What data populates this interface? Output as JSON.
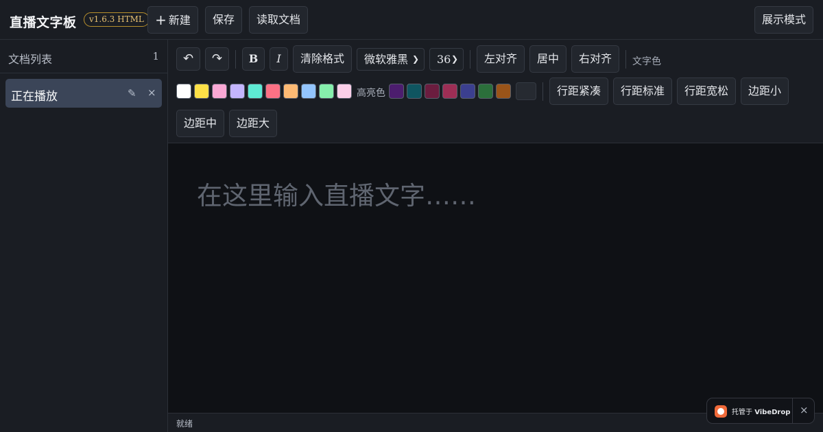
{
  "header": {
    "title": "直播文字板",
    "version": "v1.6.3 HTML",
    "new_icon": "plus-icon",
    "new_label": "新建",
    "save_label": "保存",
    "open_label": "读取文档",
    "present_label": "展示模式"
  },
  "sidebar": {
    "title": "文档列表",
    "count": "1",
    "items": [
      {
        "label": "正在播放",
        "edit_icon": "pencil-icon",
        "close_icon": "close-icon"
      }
    ]
  },
  "toolbar": {
    "undo_icon": "undo-icon",
    "redo_icon": "redo-icon",
    "bold_label": "B",
    "italic_label": "I",
    "clear_label": "清除格式",
    "font_value": "微软雅黑",
    "size_value": "36",
    "align_left": "左对齐",
    "align_center": "居中",
    "align_right": "右对齐",
    "text_color_label": "文字色",
    "text_colors": [
      "#ffffff",
      "#fde047",
      "#f9a8d4",
      "#c4b5fd",
      "#5eead4",
      "#fb7185",
      "#fdba74",
      "#93c5fd",
      "#86efac",
      "#fbcfe8"
    ],
    "highlight_label": "高亮色",
    "highlight_colors": [
      "#4c1d6e",
      "#0f5560",
      "#6b1d3f",
      "#9d2e55",
      "#3b3f8f",
      "#2b6f3b",
      "#9a5419"
    ],
    "line_tight": "行距紧凑",
    "line_normal": "行距标准",
    "line_loose": "行距宽松",
    "margin_small": "边距小",
    "margin_medium": "边距中",
    "margin_large": "边距大"
  },
  "editor": {
    "placeholder": "在这里输入直播文字……"
  },
  "status": {
    "text": "就绪"
  },
  "badge": {
    "prefix": "托管于",
    "brand": "VibeDrop",
    "close_icon": "close-icon"
  },
  "colors": {
    "accent_badge": "#b8902d",
    "active_doc": "#3b4558",
    "vibedrop_logo": "#f06a3a"
  }
}
